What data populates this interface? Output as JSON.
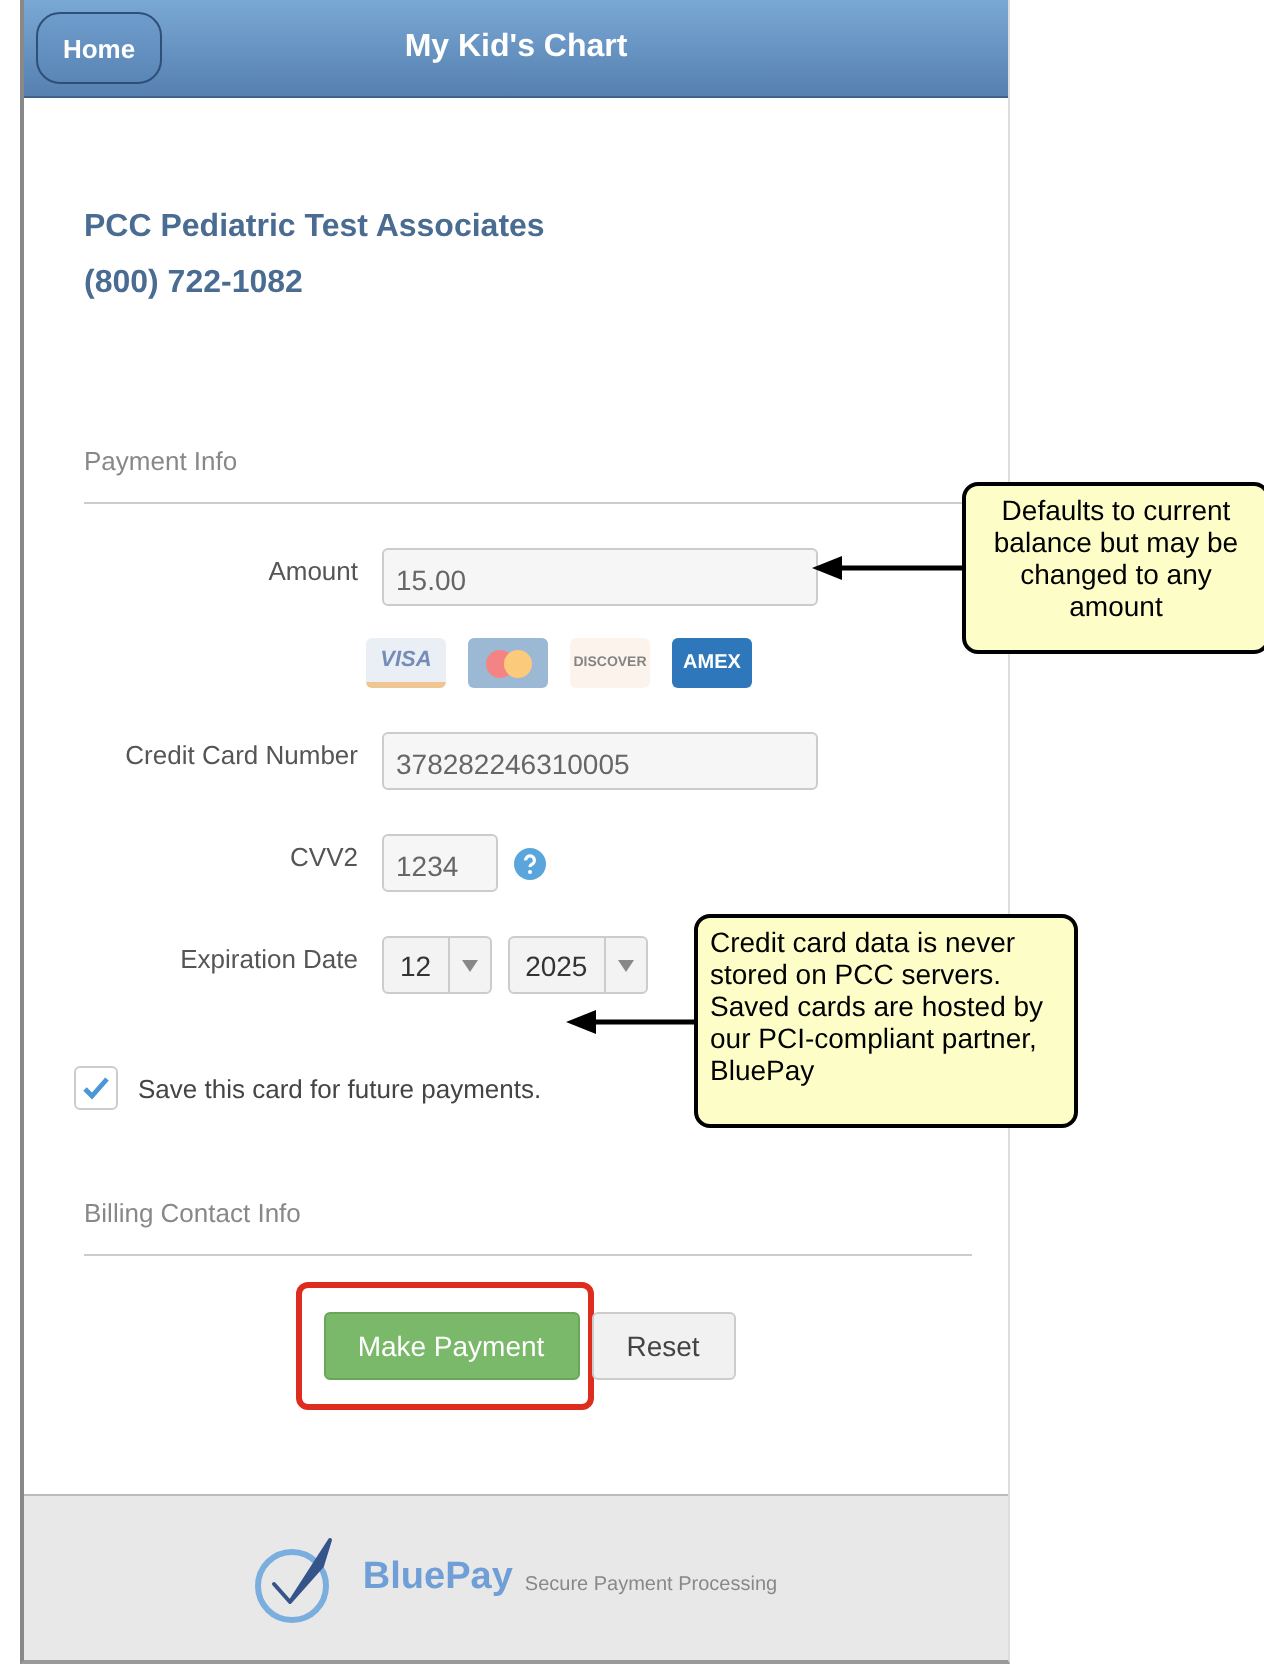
{
  "header": {
    "home_button": "Home",
    "title": "My Kid's Chart"
  },
  "practice": {
    "name": "PCC Pediatric Test Associates",
    "phone": "(800) 722-1082"
  },
  "payment_info": {
    "heading": "Payment Info",
    "amount": {
      "label": "Amount",
      "value": "15.00"
    },
    "cards": [
      {
        "kind": "visa",
        "label": "VISA",
        "selected": false
      },
      {
        "kind": "mastercard",
        "selected": false
      },
      {
        "kind": "discover",
        "label": "DISCOVER",
        "selected": false
      },
      {
        "kind": "amex",
        "label": "AMEX",
        "selected": true
      }
    ],
    "card_number": {
      "label": "Credit Card Number",
      "value": "378282246310005"
    },
    "cvv": {
      "label": "CVV2",
      "value": "1234"
    },
    "expiration": {
      "label": "Expiration Date",
      "month": "12",
      "year": "2025"
    },
    "save_card": {
      "label": "Save this card for future payments.",
      "checked": true
    }
  },
  "billing_contact": {
    "heading": "Billing Contact Info"
  },
  "buttons": [
    {
      "kind": "primary",
      "label": "Make Payment",
      "highlighted": true
    },
    {
      "kind": "secondary",
      "label": "Reset",
      "highlighted": false
    }
  ],
  "footer": {
    "brand": "BluePay",
    "tagline": "Secure Payment Processing"
  },
  "callouts": [
    {
      "text": "Defaults to current balance but may be changed to any amount"
    },
    {
      "text": "Credit card data is never stored on PCC servers. Saved cards are hosted by our PCI-compliant partner, BluePay"
    }
  ]
}
